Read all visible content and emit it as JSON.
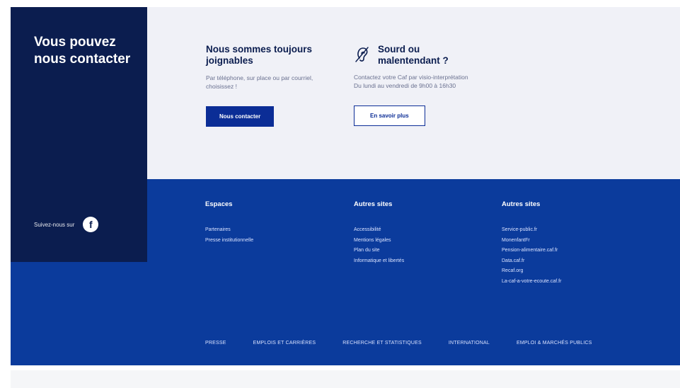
{
  "left_panel": {
    "title": "Vous pouvez nous contacter",
    "follow_label": "Suivez-nous sur",
    "social_icon": "facebook-icon",
    "social_glyph": "f"
  },
  "contact": {
    "phone": {
      "title": "Nous sommes toujours joignables",
      "text": "Par téléphone, sur place ou par courriel, choisissez !",
      "button": "Nous contacter"
    },
    "deaf": {
      "icon": "ear-icon",
      "title": "Sourd ou malentendant ?",
      "text_line1": "Contactez votre Caf par visio-interprétation",
      "text_line2": "Du lundi au vendredi de 9h00 à 16h30",
      "button": "En savoir plus"
    }
  },
  "footer": {
    "columns": [
      {
        "heading": "Espaces",
        "links": [
          "Partenaires",
          "Presse institutionnelle"
        ]
      },
      {
        "heading": "Autres sites",
        "links": [
          "Accessibilité",
          "Mentions légales",
          "Plan du site",
          "Informatique et libertés"
        ]
      },
      {
        "heading": "Autres sites",
        "links": [
          "Service-public.fr",
          "MonenfantFr",
          "Pension-alimentaire.caf.fr",
          "Data.caf.fr",
          "Recaf.org",
          "La-caf-a-votre-ecoute.caf.fr"
        ]
      }
    ],
    "bottom_links": [
      "PRESSE",
      "EMPLOIS ET CARRIÈRES",
      "RECHERCHE ET STATISTIQUES",
      "INTERNATIONAL",
      "EMPLOI & MARCHÉS PUBLICS"
    ]
  },
  "colors": {
    "dark_navy": "#0b1d4f",
    "footer_blue": "#0b3b9c",
    "button_blue": "#0b2d96",
    "light_bg": "#f0f1f7"
  }
}
